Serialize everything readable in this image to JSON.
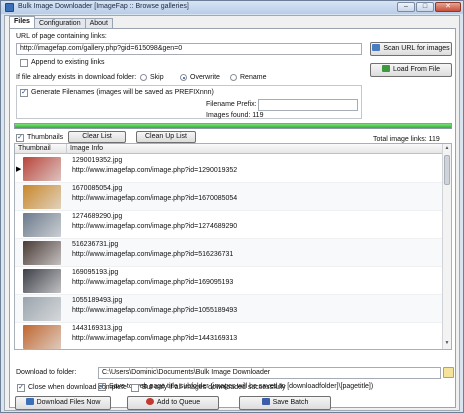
{
  "window": {
    "title": "Bulk Image Downloader [ImageFap :: Browse galleries]",
    "controls": {
      "minimize": "–",
      "maximize": "□",
      "close": "✕"
    }
  },
  "tabs": [
    "Files",
    "Configuration",
    "About"
  ],
  "form": {
    "url_label": "URL of page containing links:",
    "url_value": "http://imagefap.com/gallery.php?gid=615098&gen=0",
    "scan_button": "Scan URL for images",
    "append_label": "Append to existing links",
    "append_checked": false,
    "load_button": "Load From File",
    "exists_label": "If file already exists in download folder:",
    "exists_options": [
      "Skip",
      "Overwrite",
      "Rename"
    ],
    "exists_selected": "Overwrite",
    "generate_label": "Generate Filenames (images will be saved as PREFIXnnn)",
    "generate_checked": true,
    "prefix_label": "Filename Prefix:",
    "prefix_value": "",
    "images_found": "Images found: 119"
  },
  "progress": {
    "value": 1.0,
    "color": "#2fb12f"
  },
  "toolbar": {
    "thumbnails_label": "Thumbnails",
    "thumbnails_checked": true,
    "clear_list": "Clear List",
    "clean_up_list": "Clean Up List",
    "total_links": "Total image links: 119"
  },
  "grid": {
    "columns": [
      "Thumbnail",
      "Image Info"
    ],
    "rows": [
      {
        "filename": "1290019352.jpg",
        "url": "http://www.imagefap.com/image.php?id=1290019352",
        "thumb_color": "#b8453a",
        "selected": true
      },
      {
        "filename": "1670085054.jpg",
        "url": "http://www.imagefap.com/image.php?id=1670085054",
        "thumb_color": "#c8872a",
        "selected": false
      },
      {
        "filename": "1274689290.jpg",
        "url": "http://www.imagefap.com/image.php?id=1274689290",
        "thumb_color": "#6b7a8c",
        "selected": false
      },
      {
        "filename": "516236731.jpg",
        "url": "http://www.imagefap.com/image.php?id=516236731",
        "thumb_color": "#4a3a35",
        "selected": false
      },
      {
        "filename": "169095193.jpg",
        "url": "http://www.imagefap.com/image.php?id=169095193",
        "thumb_color": "#3e4048",
        "selected": false
      },
      {
        "filename": "1055189493.jpg",
        "url": "http://www.imagefap.com/image.php?id=1055189493",
        "thumb_color": "#9aa4ad",
        "selected": false
      },
      {
        "filename": "1443169313.jpg",
        "url": "http://www.imagefap.com/image.php?id=1443169313",
        "thumb_color": "#c0672f",
        "selected": false
      }
    ]
  },
  "download": {
    "folder_label": "Download to folder:",
    "folder_value": "C:\\Users\\Dominic\\Documents\\Bulk Image Downloader",
    "subfolder_label": "Save to web page title subfolder (images will be saved to [downloadfolder]\\[pagetitle])",
    "subfolder_checked": true,
    "close_label": "Close when download complete",
    "close_checked": true,
    "only_if_label": "But only if all images downloaded successfully",
    "only_if_checked": false,
    "download_button": "Download Files Now",
    "queue_button": "Add to Queue",
    "batch_button": "Save Batch"
  }
}
